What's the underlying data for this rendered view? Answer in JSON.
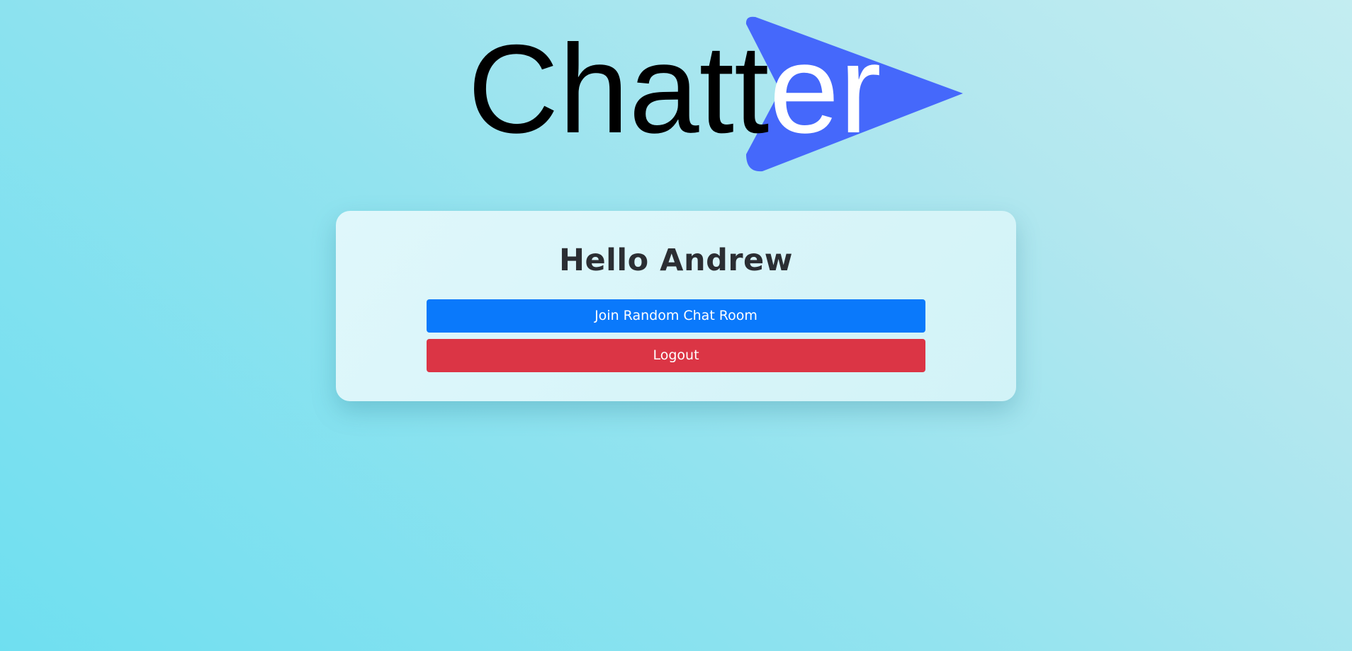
{
  "logo": {
    "text_dark": "Chatt",
    "text_light": "er",
    "arrow_color": "#4568fb",
    "text_color": "#000000",
    "text_on_arrow_color": "#ffffff"
  },
  "card": {
    "greeting": "Hello Andrew",
    "join_button_label": "Join Random Chat Room",
    "logout_button_label": "Logout"
  },
  "colors": {
    "join_button": "#0a79fb",
    "logout_button": "#db3545",
    "greeting_text": "#2b2e33"
  }
}
